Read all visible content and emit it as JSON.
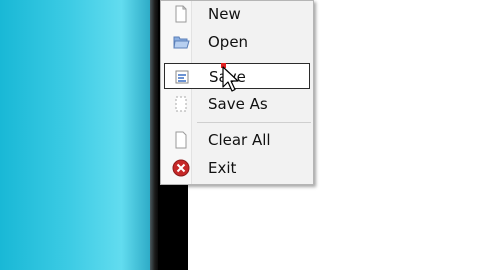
{
  "menu": {
    "items": [
      {
        "label": "New",
        "icon": "new-document-icon"
      },
      {
        "label": "Open",
        "icon": "open-folder-icon"
      },
      {
        "label": "Save",
        "icon": "save-icon",
        "highlighted": true
      },
      {
        "label": "Save As",
        "icon": "save-as-icon"
      },
      {
        "label": "Clear All",
        "icon": "clear-all-icon"
      },
      {
        "label": "Exit",
        "icon": "exit-icon"
      }
    ]
  },
  "colors": {
    "desktop": "#3ccbe4",
    "menu_background": "#f2f2f2",
    "exit_icon": "#c62828",
    "highlight_border": "#2b2b2b"
  }
}
